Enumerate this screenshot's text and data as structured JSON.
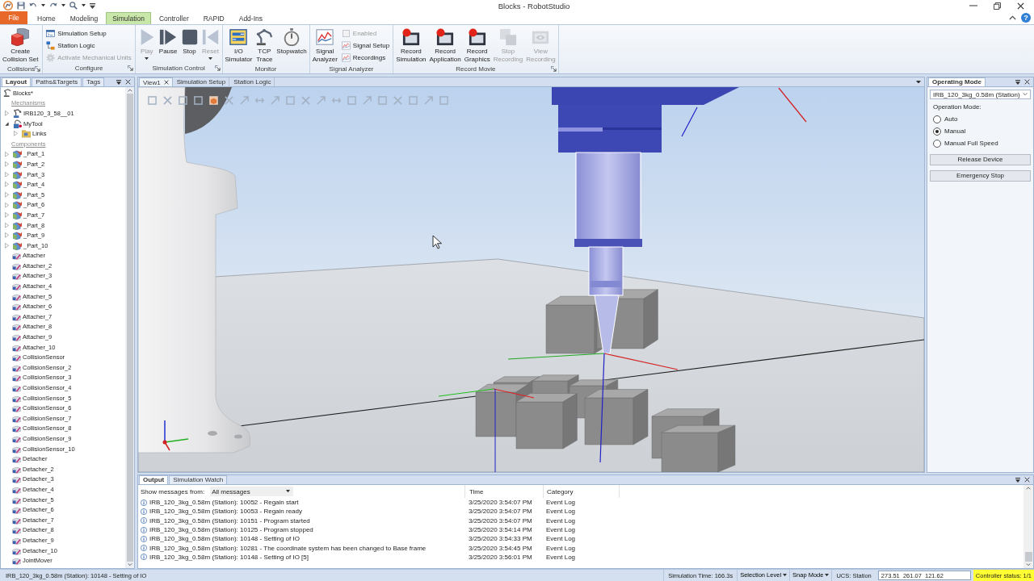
{
  "title_bar": {
    "title": "Blocks - RobotStudio"
  },
  "file_tab": {
    "label": "File"
  },
  "ribbon_tabs": [
    {
      "label": "Home",
      "selected": false
    },
    {
      "label": "Modeling",
      "selected": false
    },
    {
      "label": "Simulation",
      "selected": true
    },
    {
      "label": "Controller",
      "selected": false
    },
    {
      "label": "RAPID",
      "selected": false
    },
    {
      "label": "Add-Ins",
      "selected": false
    }
  ],
  "help_button": "?",
  "ribbon_groups": [
    {
      "title": "Collisions",
      "launcher": true,
      "items": [
        {
          "kind": "large",
          "label": "Create\nCollision Set",
          "disabled": false,
          "dropdown": false
        }
      ]
    },
    {
      "title": "Configure",
      "launcher": true,
      "items": [
        {
          "kind": "small",
          "label": "Simulation Setup",
          "disabled": false
        },
        {
          "kind": "small",
          "label": "Station Logic",
          "disabled": false
        },
        {
          "kind": "small",
          "label": "Activate Mechanical Units",
          "disabled": true
        }
      ]
    },
    {
      "title": "Simulation Control",
      "launcher": true,
      "items": [
        {
          "kind": "large",
          "label": "Play",
          "disabled": true,
          "dropdown": true
        },
        {
          "kind": "large",
          "label": "Pause",
          "disabled": false,
          "dropdown": false
        },
        {
          "kind": "large",
          "label": "Stop",
          "disabled": false,
          "dropdown": false
        },
        {
          "kind": "large",
          "label": "Reset",
          "disabled": true,
          "dropdown": true
        }
      ]
    },
    {
      "title": "Monitor",
      "launcher": false,
      "items": [
        {
          "kind": "large",
          "label": "I/O\nSimulator",
          "disabled": false,
          "dropdown": false
        },
        {
          "kind": "large",
          "label": "TCP\nTrace",
          "disabled": false,
          "dropdown": false
        },
        {
          "kind": "large",
          "label": "Stopwatch",
          "disabled": false,
          "dropdown": false
        }
      ]
    },
    {
      "title": "Signal Analyzer",
      "launcher": false,
      "items": [
        {
          "kind": "large",
          "label": "Signal\nAnalyzer",
          "disabled": false,
          "dropdown": false
        },
        {
          "kind": "check",
          "label": "Enabled",
          "checked": false,
          "disabled": true
        },
        {
          "kind": "small",
          "label": "Signal Setup",
          "disabled": false
        },
        {
          "kind": "small",
          "label": "Recordings",
          "disabled": false
        }
      ]
    },
    {
      "title": "Record Movie",
      "launcher": true,
      "items": [
        {
          "kind": "large",
          "label": "Record\nSimulation",
          "disabled": false,
          "dropdown": false
        },
        {
          "kind": "large",
          "label": "Record\nApplication",
          "disabled": false,
          "dropdown": false
        },
        {
          "kind": "large",
          "label": "Record\nGraphics",
          "disabled": false,
          "dropdown": false
        },
        {
          "kind": "large",
          "label": "Stop\nRecording",
          "disabled": true,
          "dropdown": false
        },
        {
          "kind": "large",
          "label": "View\nRecording",
          "disabled": true,
          "dropdown": false
        }
      ]
    }
  ],
  "layout_panel": {
    "tabs": [
      {
        "label": "Layout",
        "selected": true
      },
      {
        "label": "Paths&Targets",
        "selected": false
      },
      {
        "label": "Tags",
        "selected": false
      }
    ],
    "tree": {
      "root": "Blocks*",
      "sections": [
        {
          "heading": "Mechanisms",
          "items": [
            {
              "label": "IRB120_3_58__01",
              "kind": "robot",
              "expanded": false
            },
            {
              "label": "MyTool",
              "kind": "tool",
              "expanded": true,
              "children": [
                {
                  "label": "Links",
                  "kind": "folder",
                  "expanded": false
                }
              ]
            }
          ]
        },
        {
          "heading": "Components",
          "items": [
            {
              "label": "_Part_1",
              "kind": "part",
              "expanded": false
            },
            {
              "label": "_Part_2",
              "kind": "part",
              "expanded": false
            },
            {
              "label": "_Part_3",
              "kind": "part",
              "expanded": false
            },
            {
              "label": "_Part_4",
              "kind": "part",
              "expanded": false
            },
            {
              "label": "_Part_5",
              "kind": "part",
              "expanded": false
            },
            {
              "label": "_Part_6",
              "kind": "part",
              "expanded": false
            },
            {
              "label": "_Part_7",
              "kind": "part",
              "expanded": false
            },
            {
              "label": "_Part_8",
              "kind": "part",
              "expanded": false
            },
            {
              "label": "_Part_9",
              "kind": "part",
              "expanded": false
            },
            {
              "label": "_Part_10",
              "kind": "part",
              "expanded": false
            }
          ],
          "smart_components": [
            "Attacher",
            "Attacher_2",
            "Attacher_3",
            "Attacher_4",
            "Attacher_5",
            "Attacher_6",
            "Attacher_7",
            "Attacher_8",
            "Attacher_9",
            "Attacher_10",
            "CollisionSensor",
            "CollisionSensor_2",
            "CollisionSensor_3",
            "CollisionSensor_4",
            "CollisionSensor_5",
            "CollisionSensor_6",
            "CollisionSensor_7",
            "CollisionSensor_8",
            "CollisionSensor_9",
            "CollisionSensor_10",
            "Detacher",
            "Detacher_2",
            "Detacher_3",
            "Detacher_4",
            "Detacher_5",
            "Detacher_6",
            "Detacher_7",
            "Detacher_8",
            "Detacher_9",
            "Detacher_10",
            "JointMover"
          ]
        }
      ]
    }
  },
  "viewport": {
    "tabs": [
      {
        "label": "View1",
        "selected": true
      },
      {
        "label": "Simulation Setup",
        "selected": false
      },
      {
        "label": "Station Logic",
        "selected": false
      }
    ]
  },
  "operating_mode_panel": {
    "tab": "Operating Mode",
    "device": "IRB_120_3kg_0.58m (Station)",
    "mode_label": "Operation Mode:",
    "modes": [
      {
        "label": "Auto",
        "selected": false
      },
      {
        "label": "Manual",
        "selected": true
      },
      {
        "label": "Manual Full Speed",
        "selected": false
      }
    ],
    "buttons": [
      "Release Device",
      "Emergency Stop"
    ]
  },
  "output_panel": {
    "tabs": [
      {
        "label": "Output",
        "selected": true
      },
      {
        "label": "Simulation Watch",
        "selected": false
      }
    ],
    "filter_label": "Show messages from:",
    "filter_value": "All messages",
    "columns": [
      "Time",
      "Category"
    ],
    "rows": [
      {
        "message": "IRB_120_3kg_0.58m (Station): 10052 - Regain start",
        "time": "3/25/2020 3:54:07 PM",
        "category": "Event Log"
      },
      {
        "message": "IRB_120_3kg_0.58m (Station): 10053 - Regain ready",
        "time": "3/25/2020 3:54:07 PM",
        "category": "Event Log"
      },
      {
        "message": "IRB_120_3kg_0.58m (Station): 10151 - Program started",
        "time": "3/25/2020 3:54:07 PM",
        "category": "Event Log"
      },
      {
        "message": "IRB_120_3kg_0.58m (Station): 10125 - Program stopped",
        "time": "3/25/2020 3:54:14 PM",
        "category": "Event Log"
      },
      {
        "message": "IRB_120_3kg_0.58m (Station): 10148 - Setting of IO",
        "time": "3/25/2020 3:54:33 PM",
        "category": "Event Log"
      },
      {
        "message": "IRB_120_3kg_0.58m (Station): 10281 - The coordinate system has been changed to Base frame",
        "time": "3/25/2020 3:54:45 PM",
        "category": "Event Log"
      },
      {
        "message": "IRB_120_3kg_0.58m (Station): 10148 - Setting of IO [5]",
        "time": "3/25/2020 3:56:01 PM",
        "category": "Event Log"
      }
    ]
  },
  "status_bar": {
    "message": "IRB_120_3kg_0.58m (Station): 10148 - Setting of IO",
    "simulation_time": "Simulation Time: 166.3s",
    "selection_level": "Selection Level",
    "snap_mode": "Snap Mode",
    "ucs": "UCS: Station",
    "coordinates": "273.51  261.07  121.62",
    "controller_status": "Controller status: 1/1"
  }
}
